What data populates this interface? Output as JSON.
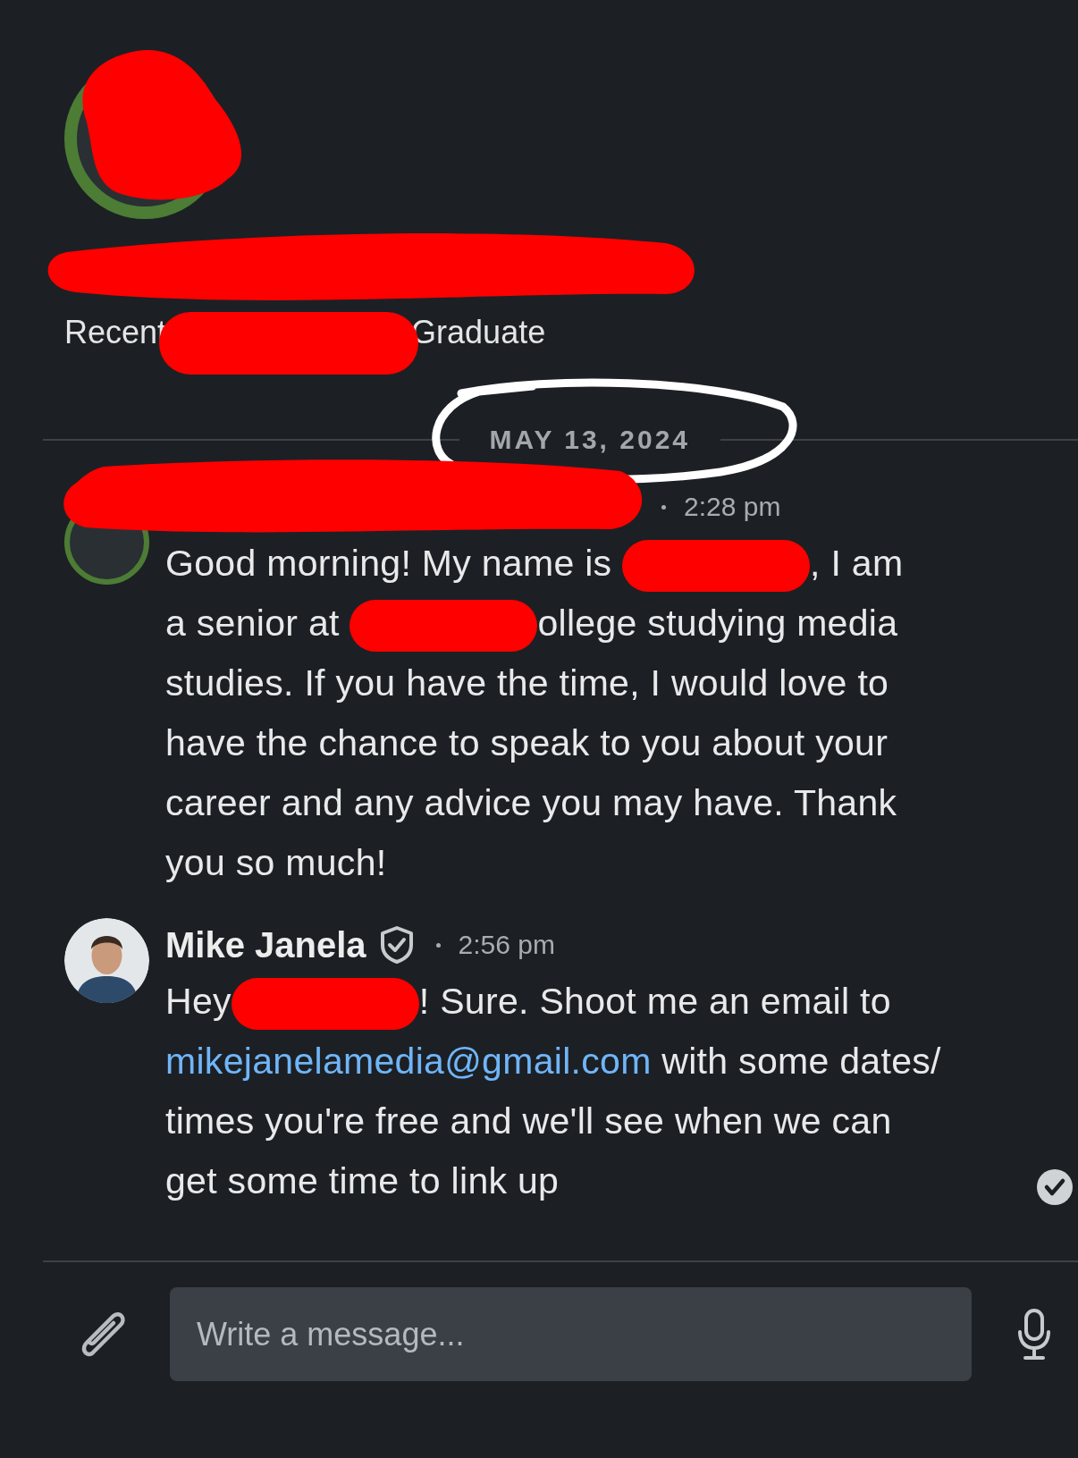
{
  "profile": {
    "open_to_work": true,
    "headline": [
      {
        "kind": "text",
        "text": "Recent"
      },
      {
        "kind": "redaction"
      },
      {
        "kind": "text",
        "text": "Graduate"
      }
    ]
  },
  "date_divider": {
    "label": "MAY 13, 2024",
    "circled": true
  },
  "messages": [
    {
      "time": "2:28 pm",
      "lines": [
        [
          {
            "kind": "text",
            "text": "Good morning! My name is "
          },
          {
            "kind": "redaction"
          },
          {
            "kind": "text",
            "text": ", I am"
          }
        ],
        [
          {
            "kind": "text",
            "text": "a senior at "
          },
          {
            "kind": "redaction"
          },
          {
            "kind": "text",
            "text": "ollege studying media"
          }
        ],
        [
          {
            "kind": "text",
            "text": "studies. If you have the time, I would love to"
          }
        ],
        [
          {
            "kind": "text",
            "text": "have the chance to speak to you about your"
          }
        ],
        [
          {
            "kind": "text",
            "text": "career and any advice you may have. Thank"
          }
        ],
        [
          {
            "kind": "text",
            "text": "you so much!"
          }
        ]
      ]
    },
    {
      "sender": "Mike Janela",
      "verified": true,
      "time": "2:56 pm",
      "seen": true,
      "lines": [
        [
          {
            "kind": "text",
            "text": "Hey"
          },
          {
            "kind": "redaction"
          },
          {
            "kind": "text",
            "text": "! Sure. Shoot me an email to"
          }
        ],
        [
          {
            "kind": "link",
            "text": "mikejanelamedia@gmail.com"
          },
          {
            "kind": "text",
            "text": " with some dates/"
          }
        ],
        [
          {
            "kind": "text",
            "text": "times you're free and we'll see when we can"
          }
        ],
        [
          {
            "kind": "text",
            "text": "get some time to link up"
          }
        ]
      ]
    }
  ],
  "composer": {
    "placeholder": "Write a message..."
  }
}
